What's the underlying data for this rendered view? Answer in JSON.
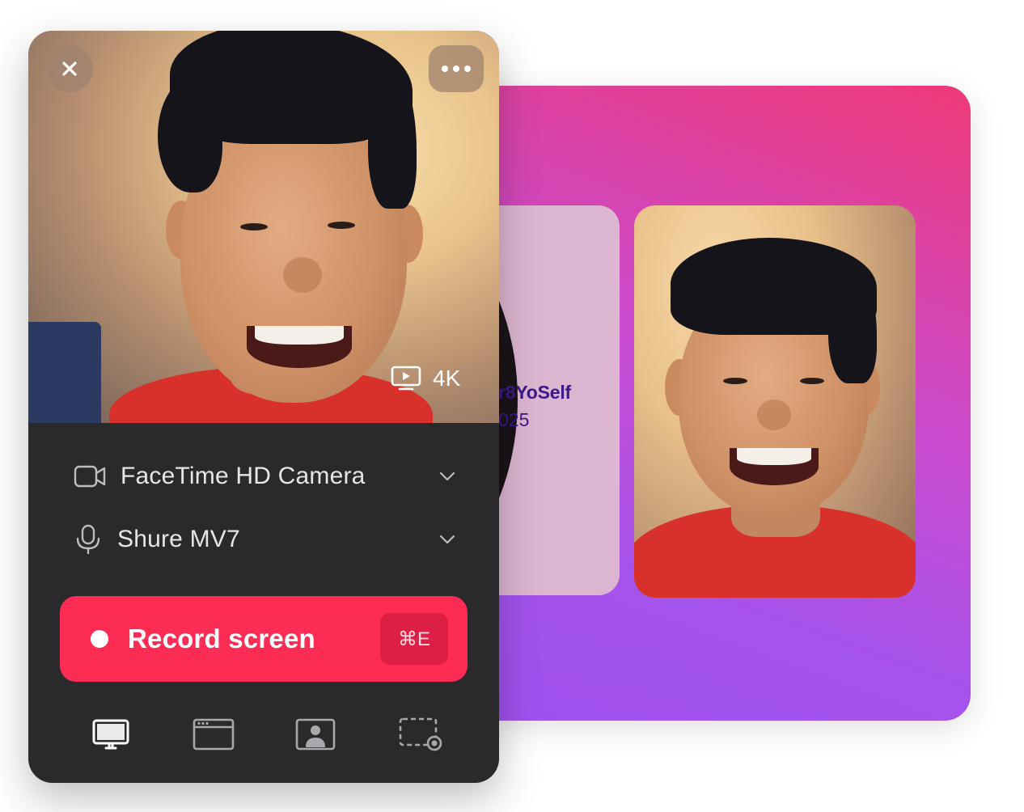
{
  "recorder": {
    "close_icon": "close-icon",
    "more_icon": "more-icon",
    "resolution": "4K",
    "camera": {
      "label": "FaceTime HD Camera"
    },
    "microphone": {
      "label": "Shure MV7"
    },
    "record_button": {
      "label": "Record screen",
      "shortcut": "⌘E"
    },
    "modes": [
      {
        "name": "full-screen",
        "icon": "monitor-icon",
        "selected": true
      },
      {
        "name": "window",
        "icon": "window-icon",
        "selected": false
      },
      {
        "name": "camera-only",
        "icon": "portrait-icon",
        "selected": false
      },
      {
        "name": "custom-area",
        "icon": "region-icon",
        "selected": false
      }
    ]
  },
  "preview_canvas": {
    "slide_title": "r8YoSelf",
    "slide_subtitle": "025"
  },
  "colors": {
    "record_red": "#fc2c55",
    "panel_bg": "#2a2a2c",
    "gradient_start": "#ee3a78",
    "gradient_end": "#a050ee"
  }
}
